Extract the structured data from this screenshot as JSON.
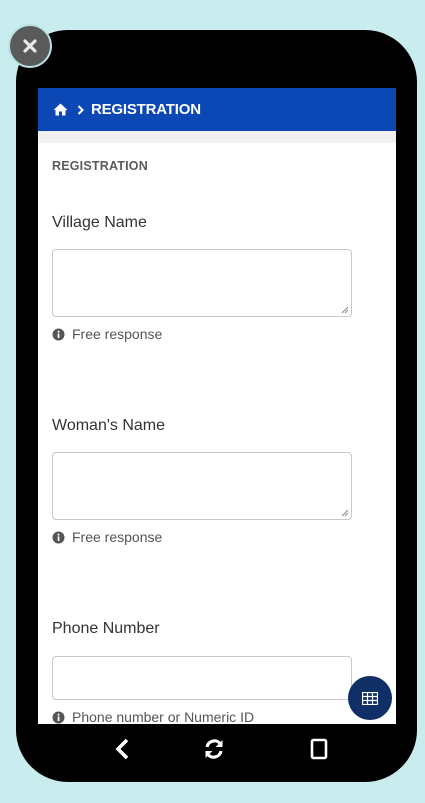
{
  "header": {
    "breadcrumb_current": "REGISTRATION"
  },
  "section": {
    "title": "REGISTRATION"
  },
  "questions": [
    {
      "label": "Village Name",
      "value": "",
      "hint": "Free response"
    },
    {
      "label": "Woman's Name",
      "value": "",
      "hint": "Free response"
    },
    {
      "label": "Phone Number",
      "value": "",
      "hint": "Phone number or Numeric ID"
    }
  ],
  "icons": {
    "close": "close-icon",
    "home": "home-icon",
    "breadcrumb_separator": "chevron-right-icon",
    "info": "info-icon",
    "fab": "grid-icon",
    "back": "back-arrow-icon",
    "refresh": "refresh-icon",
    "rotate": "rotate-device-icon"
  },
  "colors": {
    "header_bg": "#0b48b5",
    "page_bg": "#c9ecee",
    "fab_bg": "#0f2f66"
  }
}
